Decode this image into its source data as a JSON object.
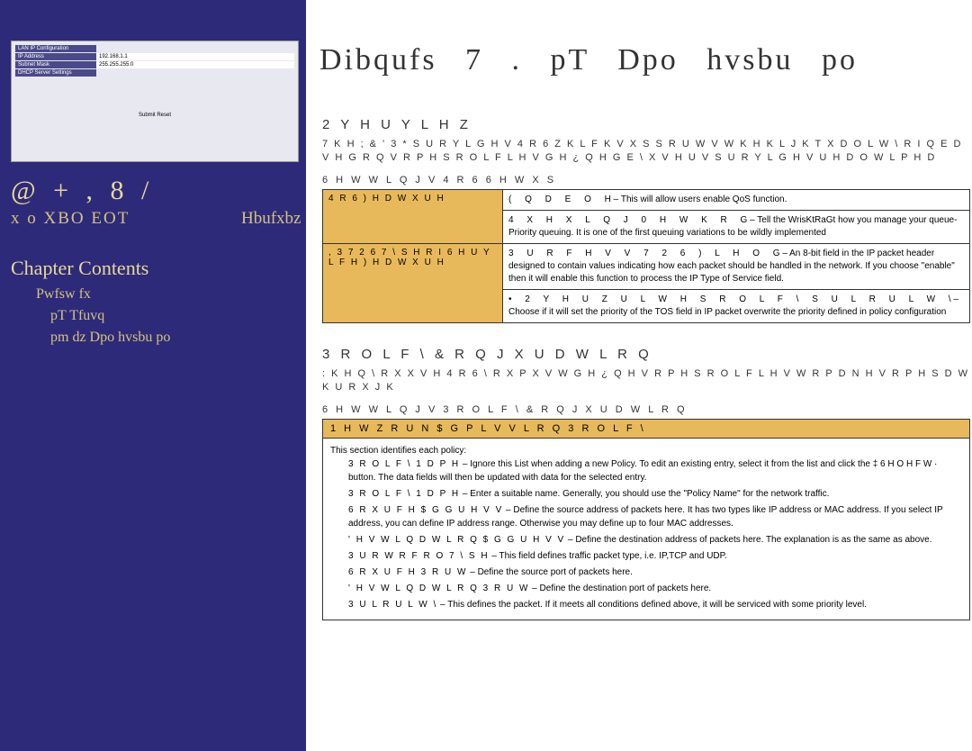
{
  "left": {
    "router_cfg": {
      "section1": "LAN IP Configuration",
      "rows": [
        {
          "label": "IP Address",
          "val": "192.168.1.1"
        },
        {
          "label": "Subnet Mask",
          "val": "255.255.255.0"
        }
      ],
      "dhcp": "DHCP Server Settings",
      "btn": "Submit  Reset"
    },
    "big": "@ + , 8 /",
    "sub": "x   o   XBO   EOT",
    "gateway": "Hbufxbz",
    "chapter_contents": "Chapter Contents",
    "toc": [
      "Pwfsw   fx",
      "pT   Tfuvq",
      "pm   dz   Dpo   hvsbu   po"
    ]
  },
  "right": {
    "title": "Dibqufs  7  .    pT  Dpo  hvsbu  po",
    "overview_head": "2 Y H U Y L H Z",
    "overview_body": "7 K H   ; &   ' 3 *     S U R Y L G H V   4 R 6     Z K L F K   V X S S R U W V   W K H   K L J K   T X D O L W \\   R I   Q   E D V H G   R Q   V R P H   S R O L F L H V   G H ¿ Q H G   E \\   X V H U V   S U R Y L G H V   U H D O   W L P H   D",
    "qos_setup_caption": "6 H W W L Q J V     4 R 6   6 H W X S",
    "qos_table": [
      {
        "label": "4 R 6  ) H D W X U H",
        "desc_lead": "( Q D E O H",
        "desc": "This will allow users enable QoS function."
      },
      {
        "label": "",
        "desc_lead": "4 X H X L Q J  0 H W K R G",
        "desc": "Tell the WrisKtRaGt how you manage your queue- Priority queuing. It is one of the first queuing variations to be wildly implemented"
      },
      {
        "label": ", 3   7 2 6   7 \\ S H   R I   6 H U Y L F H    ) H D W X U H",
        "desc_lead": "3 U R F H V V   7 2 6   ) L H O G",
        "desc": "An 8-bit field in the IP packet header designed to contain values indicating how each packet should be handled in the network. If you choose \"enable\" then it will enable this function to process the IP Type of Service field."
      },
      {
        "label": "",
        "desc_lead": "• 2 Y H U Z U L W H   S R O L F \\   S U L R U L W \\",
        "desc": "Choose if it will set the priority of the TOS field in IP packet overwrite the priority defined in policy configuration"
      }
    ],
    "policy_head": "3 R O L F \\  & R Q   J X U D W L R Q",
    "policy_body": ": K H Q   \\ R X   X V H   4 R 6     \\ R X   P X V W   G H ¿ Q H   V R P H   S R O L F L H V   W R   P D N H   V R P H   S D   W K U R X J K",
    "policy_caption": "6 H W W L Q J V     3 R O L F \\   & R Q   J X U D W L R Q",
    "policy_table_header": "1 H W Z R U N   $ G P L V V L R Q   3 R O L F \\",
    "policy_intro": "This section identifies each policy:",
    "policy_items": [
      {
        "lbl": "3 R O L F \\   1 D P H",
        "txt": "Ignore this List when adding a new Policy. To edit an existing entry, select it from the list and click the ‡ 6 H O H F W ·  button. The data fields will then be updated with data for the selected entry."
      },
      {
        "lbl": "3 R O L F \\   1 D P H",
        "txt": "Enter a suitable name. Generally, you should use the \"Policy Name\" for the network traffic."
      },
      {
        "lbl": "6 R X U F H   $ G G U H V V",
        "txt": "Define the source address of packets here. It has two types like IP address or MAC address. If you select IP address, you can define IP address range. Otherwise you may define up to four MAC addresses."
      },
      {
        "lbl": "' H V W L Q D W L R Q   $ G G U H V V",
        "txt": "Define the destination address of packets here. The explanation is as the same as above."
      },
      {
        "lbl": "3 U R W R F R O   7 \\ S H",
        "txt": "This field defines traffic packet type, i.e. IP,TCP and UDP."
      },
      {
        "lbl": "6 R X U F H   3 R U W",
        "txt": "Define the source port of packets here."
      },
      {
        "lbl": "' H V W L Q D W L R Q   3 R U W",
        "txt": "Define the destination port of packets here."
      },
      {
        "lbl": "3 U L R U L W \\",
        "txt": "This defines the packet. If it meets all conditions defined above, it will be serviced with some priority level."
      }
    ]
  }
}
